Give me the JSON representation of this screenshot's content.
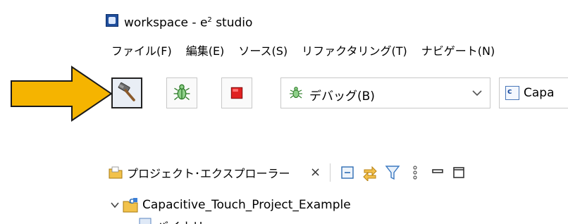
{
  "window": {
    "title_prefix": "workspace - e",
    "title_sup": "2",
    "title_suffix": " studio",
    "app_icon": "e2-studio-icon"
  },
  "menubar": {
    "items": [
      {
        "label": "ファイル(F)"
      },
      {
        "label": "編集(E)"
      },
      {
        "label": "ソース(S)"
      },
      {
        "label": "リファクタリング(T)"
      },
      {
        "label": "ナビゲート(N)"
      }
    ]
  },
  "toolbar": {
    "build_icon": "hammer-icon",
    "debug_icon": "bug-icon",
    "stop_icon": "stop-icon",
    "launch_mode": {
      "label": "デバッグ(B)",
      "icon": "bug-icon"
    },
    "launch_config": {
      "label": "Capa",
      "icon": "c-launch-config-icon",
      "icon_text": "c"
    }
  },
  "annotation": {
    "arrow_color": "#f5b400",
    "arrow_outline": "#1a1a1a"
  },
  "project_explorer": {
    "tab_label": "プロジェクト･エクスプローラー",
    "close_glyph": "×",
    "view_actions": [
      "collapse-all-icon",
      "link-with-editor-icon",
      "filter-icon",
      "view-menu-icon",
      "minimize-icon",
      "maximize-icon"
    ],
    "tree": [
      {
        "label": "Capacitive_Touch_Project_Example",
        "expanded": true
      },
      {
        "label": "バイナリー"
      }
    ]
  }
}
